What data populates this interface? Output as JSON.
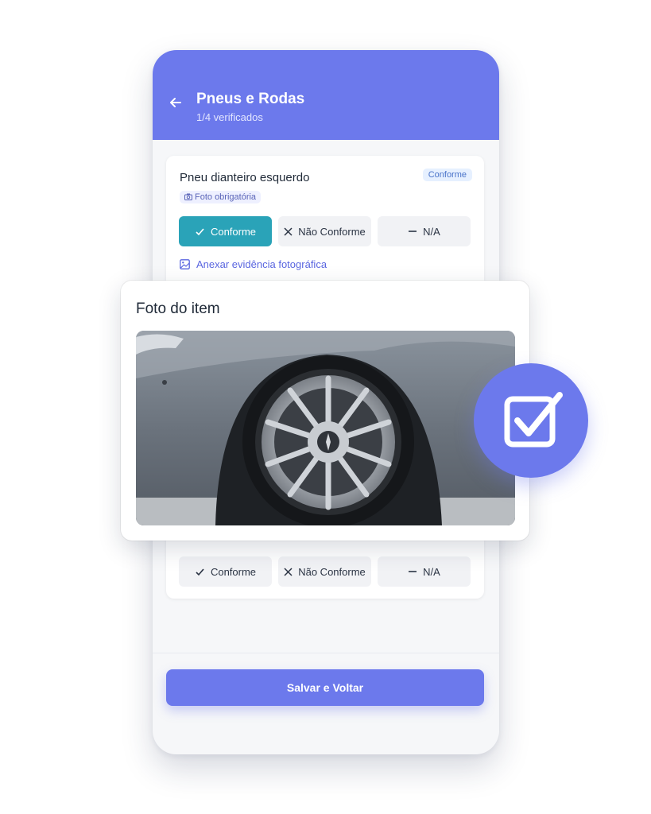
{
  "header": {
    "title": "Pneus e Rodas",
    "subtitle": "1/4 verificados",
    "back_icon": "arrow-left-icon"
  },
  "item1": {
    "title": "Pneu dianteiro esquerdo",
    "status": "Conforme",
    "photo_required": "Foto obrigatória",
    "options": [
      "Conforme",
      "Não Conforme",
      "N/A"
    ],
    "selected": "Conforme",
    "attach_label": "Anexar evidência fotográfica"
  },
  "photo_panel": {
    "title": "Foto do item"
  },
  "item2": {
    "options": [
      "Conforme",
      "Não Conforme",
      "N/A"
    ]
  },
  "footer": {
    "save_label": "Salvar e Voltar"
  },
  "colors": {
    "brand": "#6c79ec",
    "selected": "#2aa3b8"
  }
}
